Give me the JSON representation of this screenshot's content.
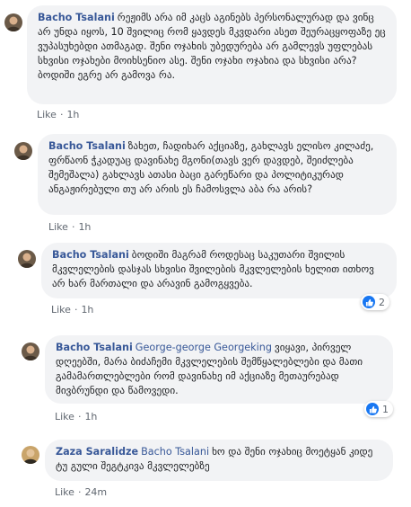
{
  "comments": [
    {
      "author": "Bacho Tsalani",
      "mention": "",
      "text": "რეჟიმს არა იმ კაცს აგინებს პერსონალურად და ვინც არ უნდა იყოს, 10 შვილიც რომ ყავდეს მკვდარი ასეთ შეურაცყოფაზე ეც ვუპასუხებდი ათმაგად. შენი ოჯახის უბედურება არ გამლევს უფლებას სხვისი ოჯახები მოიხსენიო ასე. შენი ოჯახი ოჯახია და სხვისი არა? ბოდიში ეგრე არ გამოვა რა.",
      "like": "Like",
      "time": "1h",
      "reaction_count": ""
    },
    {
      "author": "Bacho Tsalani",
      "mention": "",
      "text": "ზახეთ, ჩადიხარ აქციაზე, გახლავს ელისო კილაძე, ფრწაონ ჭკადუაც დავინახე მგონი(თავს ვერ დავდებ, შეიძლება შემეშალა) გახლავს ათასი ბაცი გარეწარი და პოლიტიკურად ანგაჟირებული თუ არ არის ეს ჩამოსვლა აბა რა არის?",
      "like": "Like",
      "time": "1h",
      "reaction_count": ""
    },
    {
      "author": "Bacho Tsalani",
      "mention": "",
      "text": "ბოდიში მაგრამ როდესაც საკუთარი შვილის მკვლელების დასჯას სხვისი შვილების მკვლელების ხელით ითხოვ არ ხარ მართალი და არავინ გამოგყვება.",
      "like": "Like",
      "time": "1h",
      "reaction_count": "2"
    },
    {
      "author": "Bacho Tsalani",
      "mention": "George-george Georgeking",
      "text": "ვიყავი, პირველ დღეებში, მარა ბიძაჩემი მკვლელების შემწყალებლები და მათი გამამართლებლები რომ დავინახე იმ აქციაზე მეთაურებად მივბრუნდი და წამოვედი.",
      "like": "Like",
      "time": "1h",
      "reaction_count": "1"
    },
    {
      "author": "Zaza Saralidze",
      "mention": "Bacho Tsalani",
      "text": "ხო და შენი ოჯახიც მოეტყან კიდე ტუ გული შეგტკივა მკვლელებზე",
      "like": "Like",
      "time": "24m",
      "reaction_count": ""
    }
  ],
  "colors": {
    "bubble": "#f2f3f5",
    "author": "#385898",
    "meta": "#606770",
    "like_reaction": "#1877f2"
  },
  "icons": [
    "avatar-photo",
    "like-thumb-icon"
  ]
}
